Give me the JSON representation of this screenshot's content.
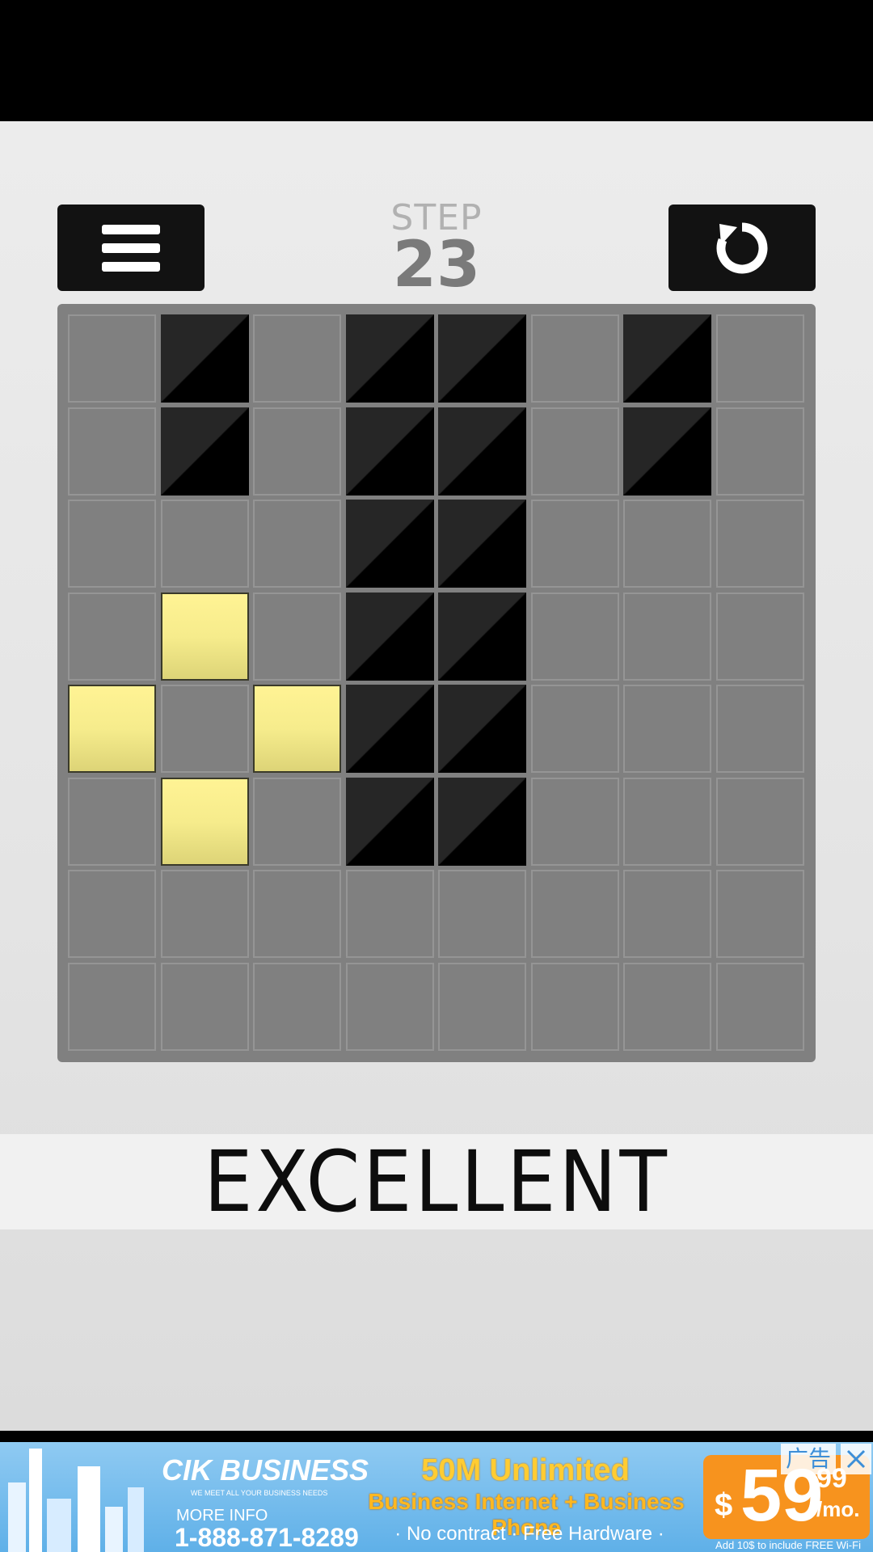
{
  "header": {
    "step_label": "STEP",
    "step_count": "23"
  },
  "board": {
    "columns": 8,
    "rows": 8,
    "cells": [
      [
        "empty",
        "black",
        "empty",
        "black",
        "black",
        "empty",
        "black",
        "empty"
      ],
      [
        "empty",
        "black",
        "empty",
        "black",
        "black",
        "empty",
        "black",
        "empty"
      ],
      [
        "empty",
        "empty",
        "empty",
        "black",
        "black",
        "empty",
        "empty",
        "empty"
      ],
      [
        "empty",
        "yellow",
        "empty",
        "black",
        "black",
        "empty",
        "empty",
        "empty"
      ],
      [
        "yellow",
        "empty",
        "yellow",
        "black",
        "black",
        "empty",
        "empty",
        "empty"
      ],
      [
        "empty",
        "yellow",
        "empty",
        "black",
        "black",
        "empty",
        "empty",
        "empty"
      ],
      [
        "empty",
        "empty",
        "empty",
        "empty",
        "empty",
        "empty",
        "empty",
        "empty"
      ],
      [
        "empty",
        "empty",
        "empty",
        "empty",
        "empty",
        "empty",
        "empty",
        "empty"
      ]
    ]
  },
  "result": {
    "text": "EXCELLENT"
  },
  "icons": {
    "menu": "menu-icon",
    "restart": "restart-icon"
  },
  "ad": {
    "brand": "CIK BUSINESS",
    "tagline": "WE MEET ALL YOUR BUSINESS NEEDS",
    "info_label": "MORE INFO",
    "phone": "1-888-871-8289",
    "headline": "50M Unlimited",
    "subline": "Business Internet + Business Phone",
    "details": "· No contract · Free Hardware ·",
    "price_currency": "$",
    "price_main": "59",
    "price_cents": "99",
    "price_unit": "/mo.",
    "price_note": "Add 10$ to include FREE Wi-Fi",
    "badge": "广告"
  },
  "colors": {
    "board": "#808080",
    "black_tile": "#000000",
    "yellow_tile": "#f6ec8c",
    "button": "#121212"
  }
}
